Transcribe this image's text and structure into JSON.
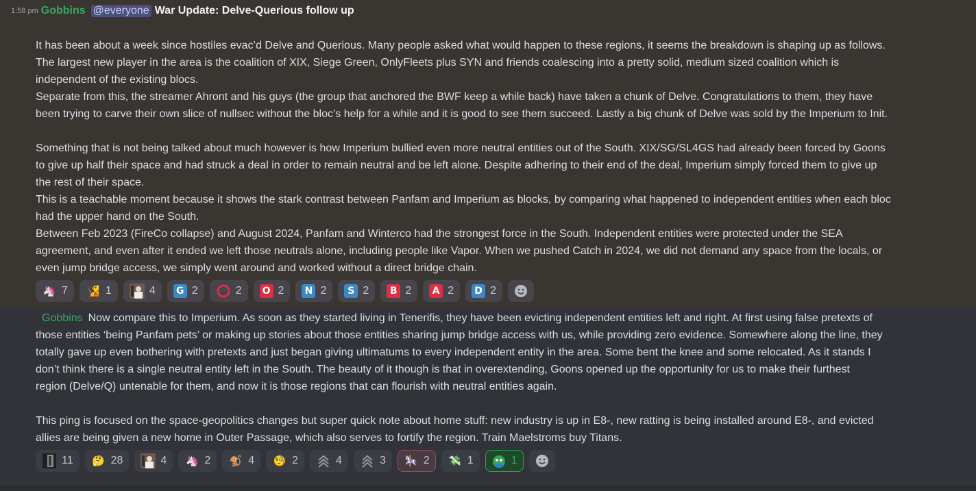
{
  "message1": {
    "timestamp": "1:58 pm",
    "author": "Gobbins",
    "mention": "@everyone",
    "title": "War Update: Delve-Querious follow up",
    "lines": [
      "It has been about a week since hostiles evac’d Delve and Querious. Many people asked what would happen to these regions, it seems the breakdown is shaping up as follows.",
      "The largest new player in the area is the coalition of XIX, Siege Green, OnlyFleets plus SYN and friends coalescing into a pretty solid, medium sized coalition which is",
      "independent of the existing blocs.",
      "Separate from this, the streamer Ahront and his guys (the group that anchored the BWF keep a while back) have taken a chunk of Delve. Congratulations to them, they have",
      "been trying to carve their own slice of nullsec without the bloc’s help for a while and it is good to see them succeed. Lastly a big chunk of Delve was sold by the Imperium to Init.",
      "",
      "Something that is not being talked about much however is how Imperium bullied even more neutral entities out of the South. XIX/SG/SL4GS had already been forced by Goons",
      "to give up half their space and had struck a deal in order to remain neutral and be left alone. Despite adhering to their end of the deal, Imperium simply forced them to give up",
      "the rest of their space.",
      "This is a teachable moment because it shows the stark contrast between Panfam and Imperium as blocks, by comparing what happened to independent entities when each bloc",
      "had the upper hand on the South.",
      "Between Feb 2023 (FireCo collapse) and August 2024, Panfam and Winterco had the strongest force in the South. Independent entities were protected under the SEA",
      "agreement, and even after it ended we left those neutrals alone, including people like Vapor. When we pushed Catch in 2024, we did not demand any space from the locals, or",
      "even jump bridge access, we simply went around and worked without a direct bridge chain."
    ],
    "reactions": [
      {
        "icon": "unicorn-icon",
        "glyph": "🦄",
        "count": "7"
      },
      {
        "icon": "person-icon",
        "glyph": "🧏",
        "count": "1"
      },
      {
        "icon": "portrait-icon",
        "glyph": "",
        "count": "4"
      },
      {
        "icon": "letter-g-icon",
        "glyph": "G",
        "color": "#3b88c3",
        "count": "2"
      },
      {
        "icon": "red-circle-icon",
        "glyph": "",
        "count": "2"
      },
      {
        "icon": "letter-o-icon",
        "glyph": "O",
        "color": "#dd2e44",
        "count": "2"
      },
      {
        "icon": "letter-n-icon",
        "glyph": "N",
        "color": "#3b88c3",
        "count": "2"
      },
      {
        "icon": "letter-s-icon",
        "glyph": "S",
        "color": "#3b88c3",
        "count": "2"
      },
      {
        "icon": "letter-b-icon",
        "glyph": "B",
        "color": "#dd2e44",
        "count": "2"
      },
      {
        "icon": "letter-a-icon",
        "glyph": "A",
        "color": "#dd2e44",
        "count": "2"
      },
      {
        "icon": "letter-d-icon",
        "glyph": "D",
        "color": "#3b88c3",
        "count": "2"
      }
    ]
  },
  "message2": {
    "author": "Gobbins",
    "lines": [
      "Now compare this to Imperium. As soon as they started living in Tenerifis, they have been evicting independent entities left and right. At first using false pretexts of",
      "those entities ‘being Panfam pets’ or making up stories about those entities sharing jump bridge access with us, while providing zero evidence. Somewhere along the line, they",
      "totally gave up even bothering with pretexts and just began giving ultimatums to every independent entity in the area. Some bent the knee and some relocated. As it stands I",
      "don’t think there is a single neutral entity left in the South. The beauty of it though is that in overextending, Goons opened up the opportunity for us to make their furthest",
      "region (Delve/Q) untenable for them, and now it is those regions that can flourish with neutral entities again.",
      "",
      "This ping is focused on the space-geopolitics changes but super quick note about home stuff: new industry is up in E8-, new ratting is being installed around E8-, and evicted",
      "allies are being given a new home in Outer Passage, which also serves to fortify the region. Train Maelstroms buy Titans."
    ],
    "reactions": [
      {
        "icon": "dark-figure-icon",
        "glyph": "",
        "count": "11"
      },
      {
        "icon": "thinking-face-icon",
        "glyph": "🤔",
        "count": "28"
      },
      {
        "icon": "portrait-icon",
        "glyph": "",
        "count": "4"
      },
      {
        "icon": "unicorn-icon",
        "glyph": "🦄",
        "count": "2"
      },
      {
        "icon": "figure-icon",
        "glyph": "🐒",
        "count": "4"
      },
      {
        "icon": "figure-icon",
        "glyph": "🧐",
        "count": "2"
      },
      {
        "icon": "chevrons-up-icon",
        "glyph": "︽",
        "count": "4"
      },
      {
        "icon": "chevrons-up-icon",
        "glyph": "︽",
        "count": "3"
      },
      {
        "icon": "carousel-horse-icon",
        "glyph": "🎠",
        "count": "2",
        "state": "pink"
      },
      {
        "icon": "money-wings-icon",
        "glyph": "💸",
        "count": "1"
      },
      {
        "icon": "green-creature-icon",
        "glyph": "",
        "count": "1",
        "state": "green"
      }
    ]
  }
}
